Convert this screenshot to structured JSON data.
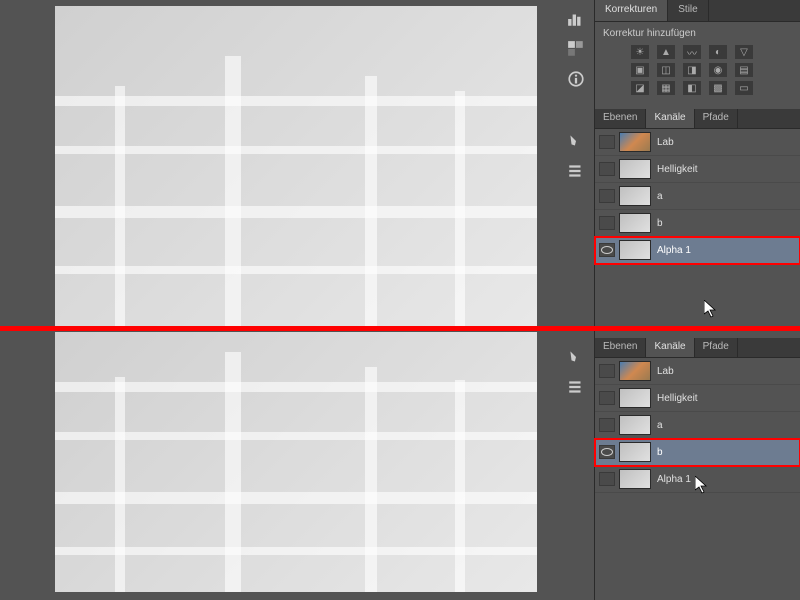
{
  "adjustments": {
    "tab1": "Korrekturen",
    "tab2": "Stile",
    "title": "Korrektur hinzufügen"
  },
  "channel_tabs": {
    "layers": "Ebenen",
    "channels": "Kanäle",
    "paths": "Pfade"
  },
  "channels_top": [
    {
      "name": "Lab",
      "selected": false,
      "eye": false,
      "hl": false,
      "thumb": "lab"
    },
    {
      "name": "Helligkeit",
      "selected": false,
      "eye": false,
      "hl": false,
      "thumb": ""
    },
    {
      "name": "a",
      "selected": false,
      "eye": false,
      "hl": false,
      "thumb": ""
    },
    {
      "name": "b",
      "selected": false,
      "eye": false,
      "hl": false,
      "thumb": ""
    },
    {
      "name": "Alpha 1",
      "selected": true,
      "eye": true,
      "hl": true,
      "thumb": ""
    }
  ],
  "channels_bot": [
    {
      "name": "Lab",
      "selected": false,
      "eye": false,
      "hl": false,
      "thumb": "lab"
    },
    {
      "name": "Helligkeit",
      "selected": false,
      "eye": false,
      "hl": false,
      "thumb": ""
    },
    {
      "name": "a",
      "selected": false,
      "eye": false,
      "hl": false,
      "thumb": ""
    },
    {
      "name": "b",
      "selected": true,
      "eye": true,
      "hl": true,
      "thumb": ""
    },
    {
      "name": "Alpha 1",
      "selected": false,
      "eye": false,
      "hl": false,
      "thumb": ""
    }
  ]
}
